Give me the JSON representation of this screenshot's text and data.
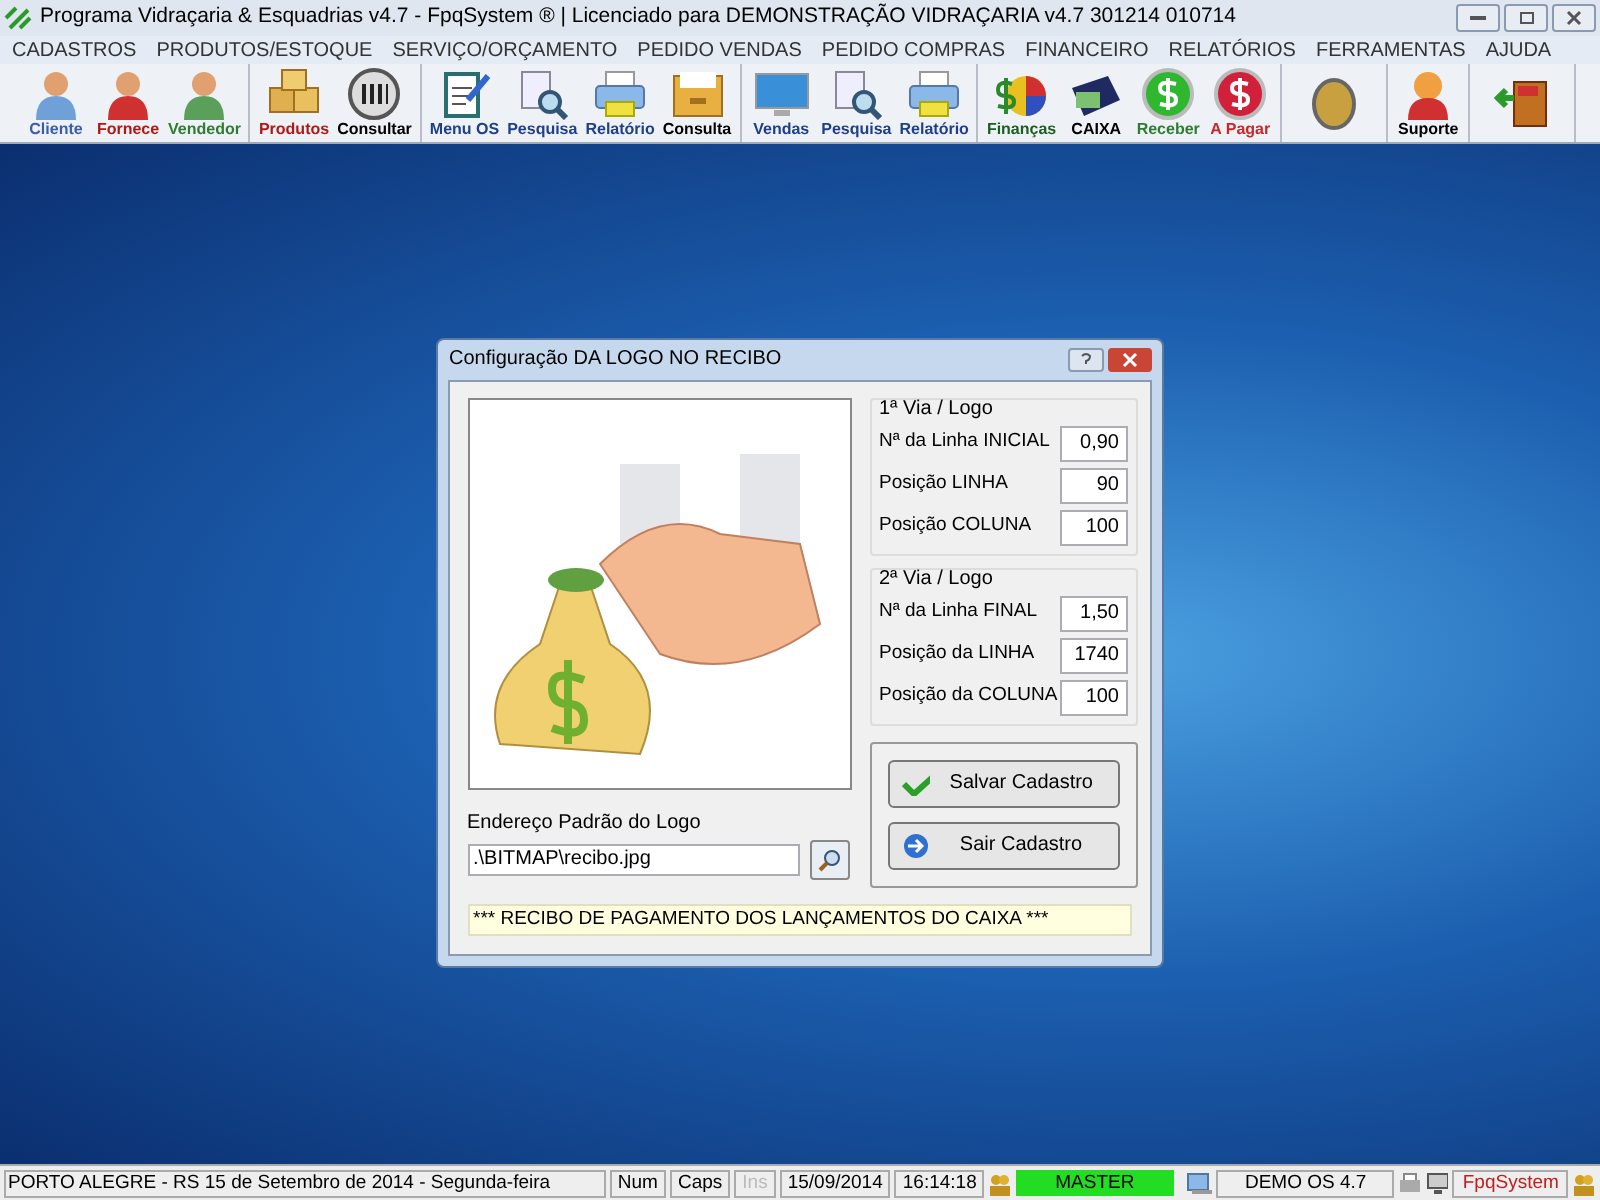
{
  "window": {
    "title": "Programa Vidraçaria & Esquadrias v4.7 - FpqSystem ® | Licenciado para  DEMONSTRAÇÃO VIDRAÇARIA v4.7 301214 010714"
  },
  "menu": [
    "CADASTROS",
    "PRODUTOS/ESTOQUE",
    "SERVIÇO/ORÇAMENTO",
    "PEDIDO VENDAS",
    "PEDIDO COMPRAS",
    "FINANCEIRO",
    "RELATÓRIOS",
    "FERRAMENTAS",
    "AJUDA"
  ],
  "toolbar": [
    [
      {
        "label": "Cliente",
        "color": "#3a5fa8"
      },
      {
        "label": "Fornece",
        "color": "#b01818"
      },
      {
        "label": "Vendedor",
        "color": "#2e7d32"
      }
    ],
    [
      {
        "label": "Produtos",
        "color": "#b01818"
      },
      {
        "label": "Consultar",
        "color": "#000000"
      }
    ],
    [
      {
        "label": "Menu OS",
        "color": "#1f3f8a"
      },
      {
        "label": "Pesquisa",
        "color": "#1f3f8a"
      },
      {
        "label": "Relatório",
        "color": "#1f3f8a"
      },
      {
        "label": "Consulta",
        "color": "#000000"
      }
    ],
    [
      {
        "label": "Vendas",
        "color": "#1f3f8a"
      },
      {
        "label": "Pesquisa",
        "color": "#1f3f8a"
      },
      {
        "label": "Relatório",
        "color": "#1f3f8a"
      }
    ],
    [
      {
        "label": "Finanças",
        "color": "#1b5e20"
      },
      {
        "label": "CAIXA",
        "color": "#000000"
      },
      {
        "label": "Receber",
        "color": "#2e7d32"
      },
      {
        "label": "A Pagar",
        "color": "#c62828"
      }
    ],
    [
      {
        "kind": "icon"
      }
    ],
    [
      {
        "label": "Suporte",
        "color": "#000000"
      }
    ],
    [
      {
        "kind": "icon"
      }
    ]
  ],
  "dialog": {
    "title": "Configuração DA LOGO NO RECIBO",
    "groups": [
      {
        "title": "1ª Via / Logo",
        "fields": [
          {
            "label": "Nª da Linha INICIAL",
            "value": "0,90"
          },
          {
            "label": "Posição LINHA",
            "value": "90"
          },
          {
            "label": "Posição COLUNA",
            "value": "100"
          }
        ]
      },
      {
        "title": "2ª Via / Logo",
        "fields": [
          {
            "label": "Nª da Linha FINAL",
            "value": "1,50"
          },
          {
            "label": "Posição da LINHA",
            "value": "1740"
          },
          {
            "label": "Posição da COLUNA",
            "value": "100"
          }
        ]
      }
    ],
    "path_label": "Endereço Padrão do Logo",
    "path_value": ".\\BITMAP\\recibo.jpg",
    "buttons": [
      {
        "label": "Salvar Cadastro",
        "kind": "save"
      },
      {
        "label": "Sair Cadastro",
        "kind": "exit"
      }
    ],
    "footer": "*** RECIBO DE PAGAMENTO DOS LANÇAMENTOS DO CAIXA ***"
  },
  "status_bar": {
    "location": "PORTO ALEGRE - RS 15 de Setembro de 2014 - Segunda-feira",
    "keys": [
      {
        "label": "Num",
        "disabled": false
      },
      {
        "label": "Caps",
        "disabled": false
      },
      {
        "label": "Ins",
        "disabled": true
      }
    ],
    "date": "15/09/2014",
    "time": "16:14:18",
    "user": "MASTER",
    "version": "DEMO OS 4.7",
    "brand": "FpqSystem"
  }
}
